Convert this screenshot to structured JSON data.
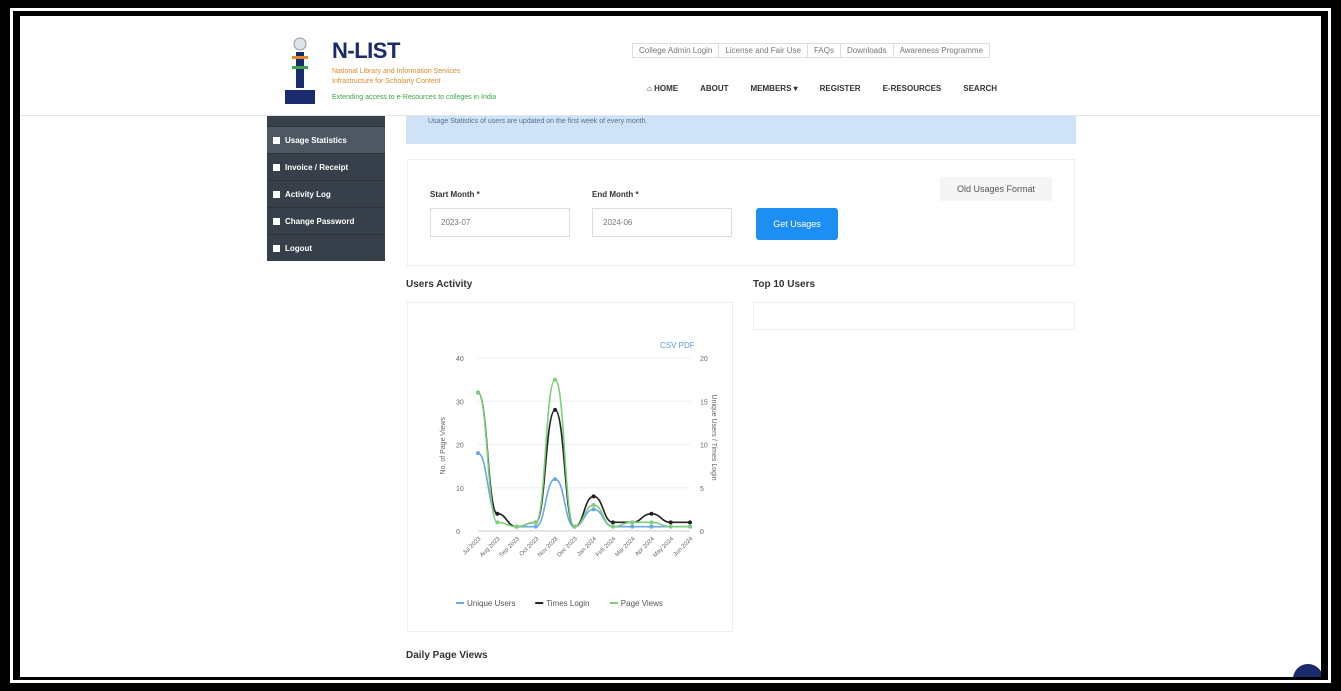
{
  "header": {
    "brand": "N-LIST",
    "tagline_1": "National Library and Information Services",
    "tagline_2": "Infrastructure for Scholarly Content",
    "tagline_3": "Extending access to e-Resources to colleges in India",
    "top_links": [
      "College Admin Login",
      "License and Fair Use",
      "FAQs",
      "Downloads",
      "Awareness Programme"
    ],
    "nav": [
      "HOME",
      "ABOUT",
      "MEMBERS ▾",
      "REGISTER",
      "E-RESOURCES",
      "SEARCH"
    ]
  },
  "sidebar": {
    "items": [
      {
        "label": "Usage Statistics",
        "icon": "bar-chart-icon"
      },
      {
        "label": "Invoice / Receipt",
        "icon": "print-icon"
      },
      {
        "label": "Activity Log",
        "icon": "list-icon"
      },
      {
        "label": "Change Password",
        "icon": "key-icon"
      },
      {
        "label": "Logout",
        "icon": "power-icon"
      }
    ]
  },
  "info": {
    "text": "Usage Statistics of users are updated on the first week of every month."
  },
  "filters": {
    "start_label": "Start Month *",
    "start_value": "2023-07",
    "end_label": "End Month *",
    "end_value": "2024-06",
    "submit": "Get Usages",
    "old_format": "Old Usages Format"
  },
  "sections": {
    "users_activity": "Users Activity",
    "top_users": "Top 10 Users",
    "daily_views": "Daily Page Views"
  },
  "chart_data": {
    "type": "line",
    "toolbar": "CSV  PDF",
    "categories": [
      "Jul 2023",
      "Aug 2023",
      "Sep 2023",
      "Oct 2023",
      "Nov 2023",
      "Dec 2023",
      "Jan 2024",
      "Feb 2024",
      "Mar 2024",
      "Apr 2024",
      "May 2024",
      "Jun 2024"
    ],
    "ylabel_left": "No. of Page Views",
    "ylabel_right": "Unique Users / Times Login",
    "y_left_ticks": [
      "0",
      "10",
      "20",
      "30",
      "40"
    ],
    "y_right_ticks": [
      "0",
      "5",
      "10",
      "15",
      "20"
    ],
    "ylim_left": [
      0,
      40
    ],
    "ylim_right": [
      0,
      20
    ],
    "series": [
      {
        "name": "Unique Users",
        "axis": "right",
        "color": "#6aa8e8",
        "values": [
          9,
          2,
          0.5,
          0.5,
          6,
          0.5,
          2.5,
          0.5,
          0.5,
          0.5,
          0.5,
          0.5
        ]
      },
      {
        "name": "Times Login",
        "axis": "right",
        "color": "#222222",
        "values": [
          16,
          2,
          0.5,
          1,
          14,
          0.5,
          4,
          1,
          1,
          2,
          1,
          1
        ]
      },
      {
        "name": "Page Views",
        "axis": "left",
        "color": "#7ecf7a",
        "values": [
          32,
          2,
          1,
          2,
          35,
          1,
          6,
          1,
          2,
          2,
          1,
          1
        ]
      }
    ],
    "legend_position": "bottom"
  }
}
